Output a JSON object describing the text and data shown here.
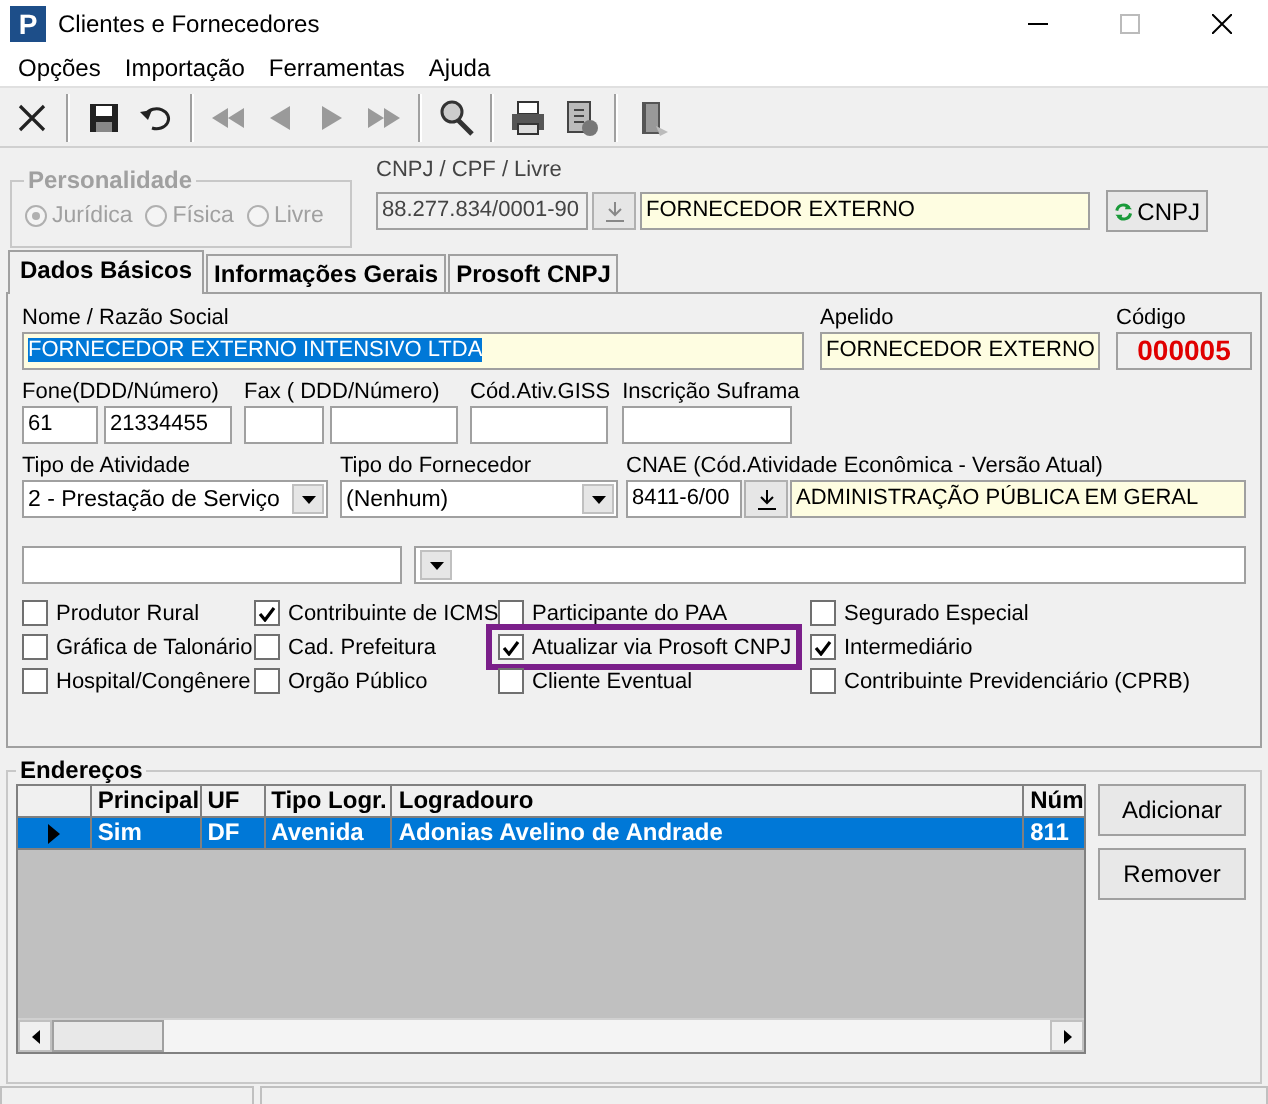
{
  "window": {
    "app_logo": "P",
    "title": "Clientes e Fornecedores"
  },
  "menu": [
    "Opções",
    "Importação",
    "Ferramentas",
    "Ajuda"
  ],
  "toolbar": [
    {
      "kind": "cancel"
    },
    {
      "kind": "separator"
    },
    {
      "kind": "save"
    },
    {
      "kind": "undo"
    },
    {
      "kind": "separator"
    },
    {
      "kind": "first"
    },
    {
      "kind": "prev"
    },
    {
      "kind": "next"
    },
    {
      "kind": "last"
    },
    {
      "kind": "separator"
    },
    {
      "kind": "search"
    },
    {
      "kind": "separator"
    },
    {
      "kind": "print"
    },
    {
      "kind": "report"
    },
    {
      "kind": "separator"
    },
    {
      "kind": "exit"
    }
  ],
  "personalidade": {
    "title": "Personalidade",
    "disabled": true,
    "options": [
      {
        "label": "Jurídica",
        "selected": true
      },
      {
        "label": "Física",
        "selected": false
      },
      {
        "label": "Livre",
        "selected": false
      }
    ]
  },
  "documento": {
    "label": "CNPJ / CPF / Livre",
    "value": "88.277.834/0001-90",
    "name_value": "FORNECEDOR EXTERNO",
    "button": "CNPJ"
  },
  "tabs": [
    {
      "label": "Dados Básicos",
      "selected": true
    },
    {
      "label": "Informações Gerais",
      "selected": false
    },
    {
      "label": "Prosoft CNPJ",
      "selected": false
    }
  ],
  "nome": {
    "label": "Nome / Razão Social",
    "value": "FORNECEDOR EXTERNO INTENSIVO LTDA",
    "text_selected": true
  },
  "apelido": {
    "label": "Apelido",
    "value": "FORNECEDOR EXTERNO"
  },
  "codigo": {
    "label": "Código",
    "value": "000005"
  },
  "fone": {
    "label": "Fone(DDD/Número)",
    "ddd": "61",
    "number": "21334455"
  },
  "fax": {
    "label": "Fax ( DDD/Número)"
  },
  "cod_ativ_giss": {
    "label": "Cód.Ativ.GISS"
  },
  "inscricao_suframa": {
    "label": "Inscrição Suframa"
  },
  "tipo_atividade": {
    "label": "Tipo de Atividade",
    "value": "2 - Prestação de Serviço"
  },
  "tipo_fornecedor": {
    "label": "Tipo do Fornecedor",
    "value": "(Nenhum)"
  },
  "cnae": {
    "label": "CNAE (Cód.Atividade Econômica - Versão Atual)",
    "code": "8411-6/00",
    "description": "ADMINISTRAÇÃO PÚBLICA EM GERAL"
  },
  "checkbox_columns": [
    [
      {
        "label": "Produtor Rural",
        "checked": false,
        "highlighted": false
      },
      {
        "label": "Gráfica de Talonário",
        "checked": false,
        "highlighted": false
      },
      {
        "label": "Hospital/Congênere",
        "checked": false,
        "highlighted": false
      }
    ],
    [
      {
        "label": "Contribuinte de ICMS",
        "checked": true,
        "highlighted": false
      },
      {
        "label": "Cad. Prefeitura",
        "checked": false,
        "highlighted": false
      },
      {
        "label": "Orgão Público",
        "checked": false,
        "highlighted": false
      }
    ],
    [
      {
        "label": "Participante do PAA",
        "checked": false,
        "highlighted": false
      },
      {
        "label": "Atualizar via Prosoft CNPJ",
        "checked": true,
        "highlighted": true
      },
      {
        "label": "Cliente Eventual",
        "checked": false,
        "highlighted": false
      }
    ],
    [
      {
        "label": "Segurado Especial",
        "checked": false,
        "highlighted": false
      },
      {
        "label": "Intermediário",
        "checked": true,
        "highlighted": false
      },
      {
        "label": "Contribuinte Previdenciário (CPRB)",
        "checked": false,
        "highlighted": false
      }
    ]
  ],
  "enderecos": {
    "title": "Endereços",
    "columns": [
      "Principal",
      "UF",
      "Tipo Logr.",
      "Logradouro",
      "Núm"
    ],
    "rows": [
      {
        "selected": true,
        "cells": [
          "Sim",
          "DF",
          "Avenida",
          "Adonias Avelino de Andrade",
          "811"
        ]
      }
    ],
    "buttons": [
      "Adicionar",
      "Remover"
    ]
  }
}
